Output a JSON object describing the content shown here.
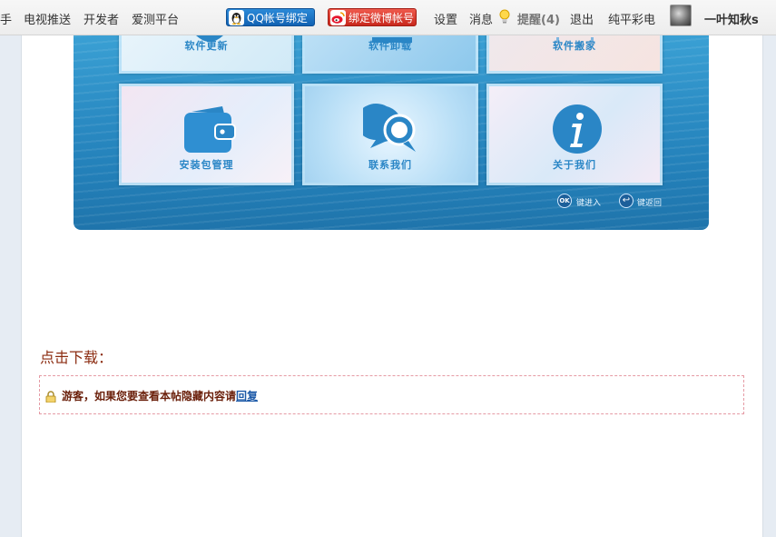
{
  "nav": {
    "items_left": [
      "手",
      "电视推送",
      "开发者",
      "爱测平台"
    ],
    "qq_bind": "QQ帐号绑定",
    "weibo_bind": "绑定微博帐号",
    "settings": "设置",
    "messages": "消息",
    "reminders": "提醒(4)",
    "logout": "退出",
    "site": "纯平彩电",
    "username": "一叶知秋s"
  },
  "app": {
    "tiles": {
      "update": "软件更新",
      "uninstall": "软件卸载",
      "move": "软件搬家",
      "package": "安装包管理",
      "contact": "联系我们",
      "about": "关于我们"
    },
    "hints": {
      "ok_label": "OK",
      "ok_text": "键进入",
      "back_text": "键返回"
    }
  },
  "download": {
    "title": "点击下载：",
    "locked_text": "游客，如果您要查看本帖隐藏内容请",
    "reply_link": "回复"
  },
  "colors": {
    "accent_blue": "#2a86c6",
    "download_title": "#8b2b10",
    "locked_text": "#6a1f0a",
    "dashed_border": "#e59aa4"
  }
}
